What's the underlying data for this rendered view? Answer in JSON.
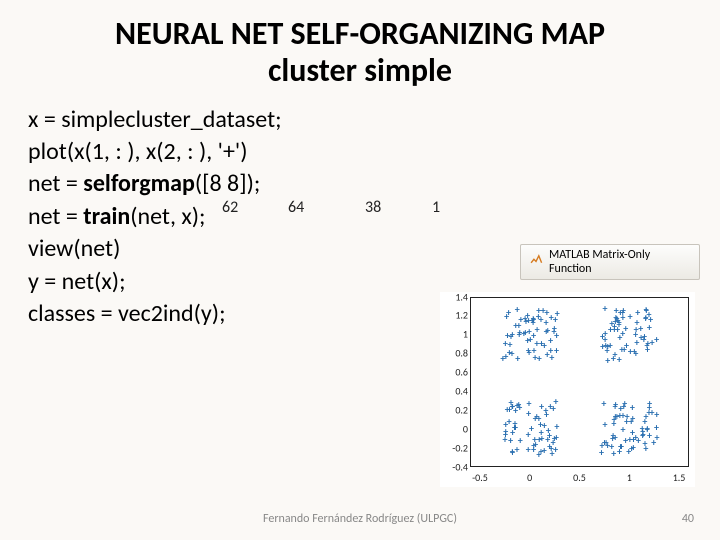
{
  "title_a": "NEURAL NET ",
  "title_b": "SELF-ORGANIZING MAP",
  "title_c": " cluster simple",
  "code": {
    "l1": "x = simplecluster_dataset;",
    "l2": "plot(x(1, : ), x(2, : ), '+')",
    "l3a": "net = ",
    "l3b": "selforgmap",
    "l3c": "([8 8]);",
    "l4a": "net = ",
    "l4b": "train",
    "l4c": "(net, x);",
    "l5": "view(net)",
    "l6": "y = net(x);",
    "l7": "classes = vec2ind(y);"
  },
  "annot": {
    "a": "62",
    "b": "64",
    "c": "38",
    "d": "1"
  },
  "badge": "MATLAB Matrix-Only Function",
  "chart_data": {
    "type": "scatter",
    "marker": "+",
    "xlabel": "",
    "ylabel": "",
    "xlim": [
      -0.6,
      1.6
    ],
    "ylim": [
      -0.4,
      1.4
    ],
    "xticks": [
      -0.5,
      0,
      0.5,
      1,
      1.5
    ],
    "yticks": [
      -0.4,
      -0.2,
      0,
      0.2,
      0.4,
      0.6,
      0.8,
      1,
      1.2,
      1.4
    ],
    "clusters": [
      {
        "cx": 0.0,
        "cy": 1.0,
        "spread": 0.28,
        "n": 60
      },
      {
        "cx": 1.0,
        "cy": 1.0,
        "spread": 0.28,
        "n": 60
      },
      {
        "cx": 0.0,
        "cy": 0.0,
        "spread": 0.28,
        "n": 60
      },
      {
        "cx": 1.0,
        "cy": 0.0,
        "spread": 0.28,
        "n": 60
      }
    ],
    "cluster_labels": [
      "62",
      "64",
      "38",
      "1"
    ]
  },
  "footer": {
    "credit": "Fernando Fernández Rodríguez (ULPGC)",
    "page": "40"
  }
}
